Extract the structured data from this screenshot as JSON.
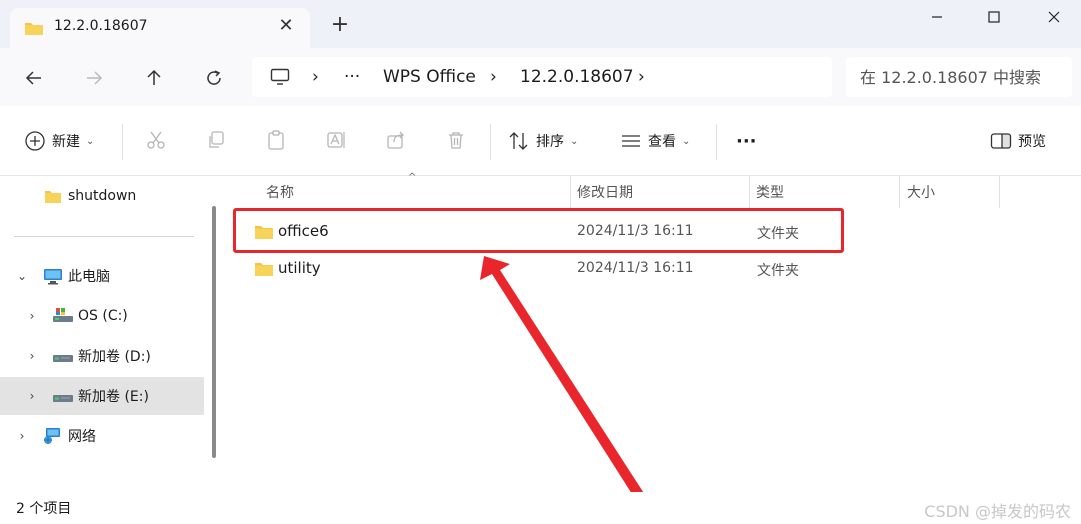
{
  "tab": {
    "title": "12.2.0.18607",
    "close": "✕",
    "new_tab": "+"
  },
  "window_controls": {
    "minimize": "—",
    "maximize": "☐",
    "close": "✕"
  },
  "address": {
    "ellipsis": "···",
    "crumbs": [
      "WPS Office",
      "12.2.0.18607"
    ],
    "sep": "›"
  },
  "search": {
    "placeholder": "在 12.2.0.18607 中搜索"
  },
  "toolbar": {
    "new_label": "新建",
    "sort_label": "排序",
    "view_label": "查看",
    "more_label": "···",
    "preview_label": "预览"
  },
  "sidebar": {
    "items": [
      {
        "label": "shutdown"
      },
      {
        "label": "此电脑"
      },
      {
        "label": "OS (C:)"
      },
      {
        "label": "新加卷 (D:)"
      },
      {
        "label": "新加卷 (E:)"
      },
      {
        "label": "网络"
      }
    ]
  },
  "columns": {
    "name": "名称",
    "modified": "修改日期",
    "type": "类型",
    "size": "大小"
  },
  "files": [
    {
      "name": "office6",
      "modified": "2024/11/3 16:11",
      "type": "文件夹"
    },
    {
      "name": "utility",
      "modified": "2024/11/3 16:11",
      "type": "文件夹"
    }
  ],
  "status": {
    "count": "2 个项目"
  },
  "watermark": "CSDN @掉发的码农",
  "colors": {
    "highlight": "#e8262b",
    "folder": "#f4c542"
  }
}
